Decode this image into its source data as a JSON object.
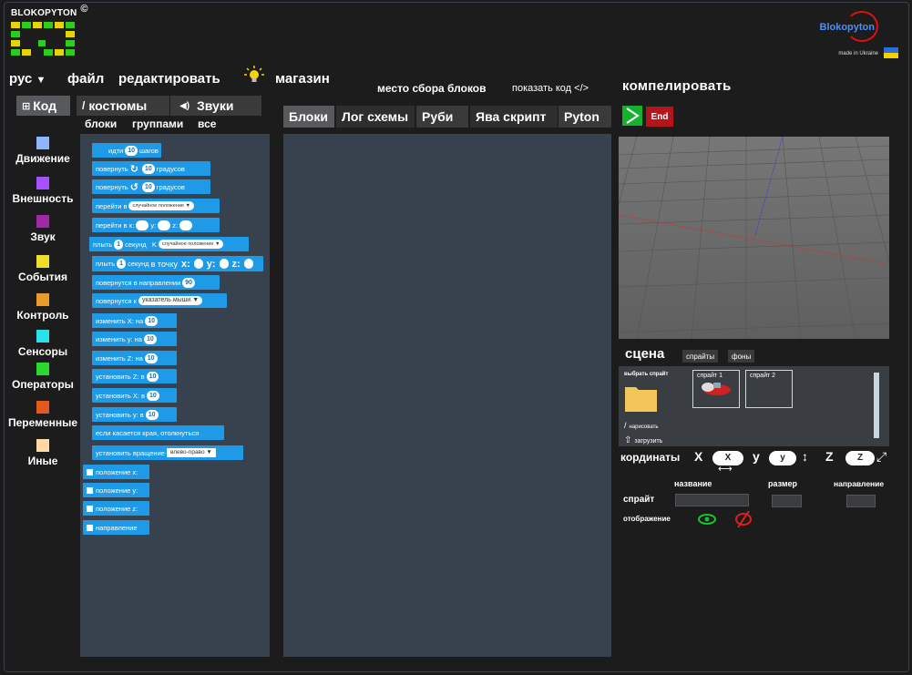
{
  "header": {
    "logo_text": "BLOKOPYTON",
    "logo_copyright": "©",
    "brand": "Blokopyton",
    "made_in": "made in Ukraine",
    "colors": {
      "logo_green": "#2ecc1f",
      "logo_yellow": "#e8d400",
      "brand_blue": "#4f8df3",
      "brand_red": "#d11111"
    }
  },
  "menu": {
    "language": "рус",
    "language_arrow": "▼",
    "file": "файл",
    "edit": "редактировать",
    "store": "магазин",
    "bulb_icon": "lightbulb-icon",
    "assembly_area": "место сбора блоков",
    "show_code": "показать код",
    "code_icon": "</>",
    "compile": "компелировать"
  },
  "left_tabs": {
    "code": "Код",
    "code_icon": "⊞",
    "costumes": "костюмы",
    "costumes_icon": "brush-icon",
    "sounds": "Звуки",
    "sounds_icon": "speaker-icon"
  },
  "filters": {
    "blocks": "блоки",
    "groups": "группами",
    "all": "все"
  },
  "center_tabs": [
    {
      "label": "Блоки",
      "active": true
    },
    {
      "label": "Лог схемы",
      "active": false
    },
    {
      "label": "Руби",
      "active": false
    },
    {
      "label": "Ява скрипт",
      "active": false
    },
    {
      "label": "Pyton",
      "active": false
    }
  ],
  "categories": [
    {
      "label": "Движение",
      "color": "#8fb3ff"
    },
    {
      "label": "Внешность",
      "color": "#a750ff"
    },
    {
      "label": "Звук",
      "color": "#a02aa6"
    },
    {
      "label": "События",
      "color": "#ece02a"
    },
    {
      "label": "Контроль",
      "color": "#e89a2b"
    },
    {
      "label": "Сенсоры",
      "color": "#2ce0ea"
    },
    {
      "label": "Операторы",
      "color": "#2bd82e"
    },
    {
      "label": "Переменные",
      "color": "#e2581f"
    },
    {
      "label": "Иные",
      "color": "#ffd9a3"
    }
  ],
  "blocks": {
    "go": {
      "pre": "идти",
      "num": "10",
      "post": "шагов"
    },
    "turn_right": {
      "pre": "повернуть",
      "icon": "↻",
      "num": "10",
      "post": "градусов"
    },
    "turn_left": {
      "pre": "повернуть",
      "icon": "↺",
      "num": "10",
      "post": "градусов"
    },
    "goto": {
      "pre": "перейти в",
      "dd": "случайное положение",
      "arrow": "▼"
    },
    "goto_xyz": {
      "pre": "перейти в x:",
      "y": "y:",
      "z": "z:"
    },
    "glide": {
      "pre": "плыть",
      "num": "1",
      "mid": "секунд",
      "k": "K",
      "dd": "случайное положение",
      "arrow": "▼"
    },
    "glide_xyz": {
      "pre": "плыть",
      "num": "1",
      "mid": "секунд",
      "post": "в точку",
      "x": "x:",
      "y": "y:",
      "z": "z:"
    },
    "point_dir": {
      "pre": "повернутся в направлении",
      "num": "90"
    },
    "point_to": {
      "pre": "повернутся к",
      "dd": "указатель мыши",
      "arrow": "▼"
    },
    "change_x": {
      "pre": "изменить X: на",
      "num": "10"
    },
    "change_y": {
      "pre": "изменить y: на",
      "num": "10"
    },
    "change_z": {
      "pre": "изменить Z: на",
      "num": "10"
    },
    "set_z": {
      "pre": "установить Z: в",
      "num": "10"
    },
    "set_x": {
      "pre": "установить X: в",
      "num": "10"
    },
    "set_y": {
      "pre": "установить y: в",
      "num": "10"
    },
    "bounce": {
      "pre": "если касается края, отолкнуться"
    },
    "rotation": {
      "pre": "установить вращение",
      "dd": "влево-право",
      "arrow": "▼"
    },
    "pos_x": "положение x:",
    "pos_y": "положение y:",
    "pos_z": "положение z:",
    "direction": "направление"
  },
  "run": {
    "play_icon": "play-icon",
    "end": "End"
  },
  "scene": {
    "title": "сцена",
    "sprites_tab": "спрайты",
    "backgrounds_tab": "фоны",
    "choose_sprite": "выбрать спрайт",
    "draw": "нарисовать",
    "upload": "загрузить",
    "sprite1": "спрайт 1",
    "sprite2": "спрайт 2"
  },
  "coords": {
    "label": "кординаты",
    "x_label": "X",
    "x_val": "X",
    "y_label": "y",
    "y_val": "y",
    "z_label": "Z",
    "z_val": "Z",
    "x_arrow": "⟷",
    "y_arrow": "↕",
    "z_arrow": "⤢"
  },
  "sprite_props": {
    "name": "название",
    "size": "размер",
    "direction": "направление",
    "sprite": "спрайт",
    "display": "отображение"
  }
}
